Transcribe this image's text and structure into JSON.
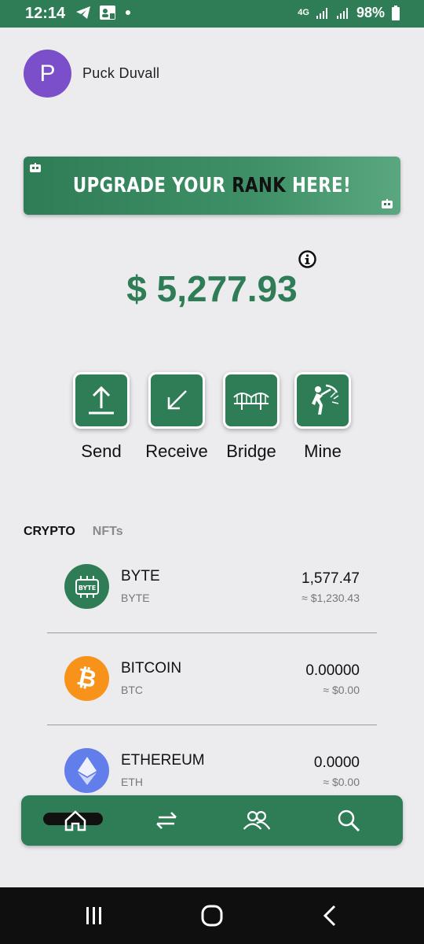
{
  "status_bar": {
    "time": "12:14",
    "network": "4G",
    "battery": "98%",
    "left_icons": [
      "telegram-icon",
      "contact-card-icon",
      "dot-icon"
    ],
    "right_icons": [
      "network-4g-icon",
      "signal-icon",
      "signal-icon",
      "battery-icon"
    ]
  },
  "profile": {
    "initial": "P",
    "name": "Puck Duvall",
    "avatar_color": "#7b4fc9"
  },
  "banner": {
    "text_part1": "UPGRADE YOUR ",
    "text_highlight": "RANK",
    "text_part2": " HERE!"
  },
  "balance": {
    "value": "$ 5,277.93"
  },
  "actions": [
    {
      "label": "Send",
      "icon": "upload-icon"
    },
    {
      "label": "Receive",
      "icon": "arrow-down-left-icon"
    },
    {
      "label": "Bridge",
      "icon": "bridge-icon"
    },
    {
      "label": "Mine",
      "icon": "miner-icon"
    }
  ],
  "tabs": [
    {
      "label": "CRYPTO",
      "active": true
    },
    {
      "label": "NFTs",
      "active": false
    }
  ],
  "assets": [
    {
      "name": "BYTE",
      "symbol": "BYTE",
      "amount": "1,577.47",
      "fiat": "≈ $1,230.43",
      "logo_color": "#2f7d57",
      "logo_text": "BYTE"
    },
    {
      "name": "BITCOIN",
      "symbol": "BTC",
      "amount": "0.00000",
      "fiat": "≈ $0.00",
      "logo_color": "#f7931a",
      "logo_text": "₿"
    },
    {
      "name": "ETHEREUM",
      "symbol": "ETH",
      "amount": "0.0000",
      "fiat": "≈ $0.00",
      "logo_color": "#627eea",
      "logo_text": ""
    }
  ],
  "bottom_nav": [
    "home-icon",
    "transfer-arrows-icon",
    "users-icon",
    "search-icon"
  ],
  "system_nav": [
    "recent-apps-icon",
    "home-button-icon",
    "back-icon"
  ],
  "colors": {
    "primary": "#2f7d57",
    "background": "#ecebee",
    "text": "#111111",
    "muted": "#777777"
  }
}
